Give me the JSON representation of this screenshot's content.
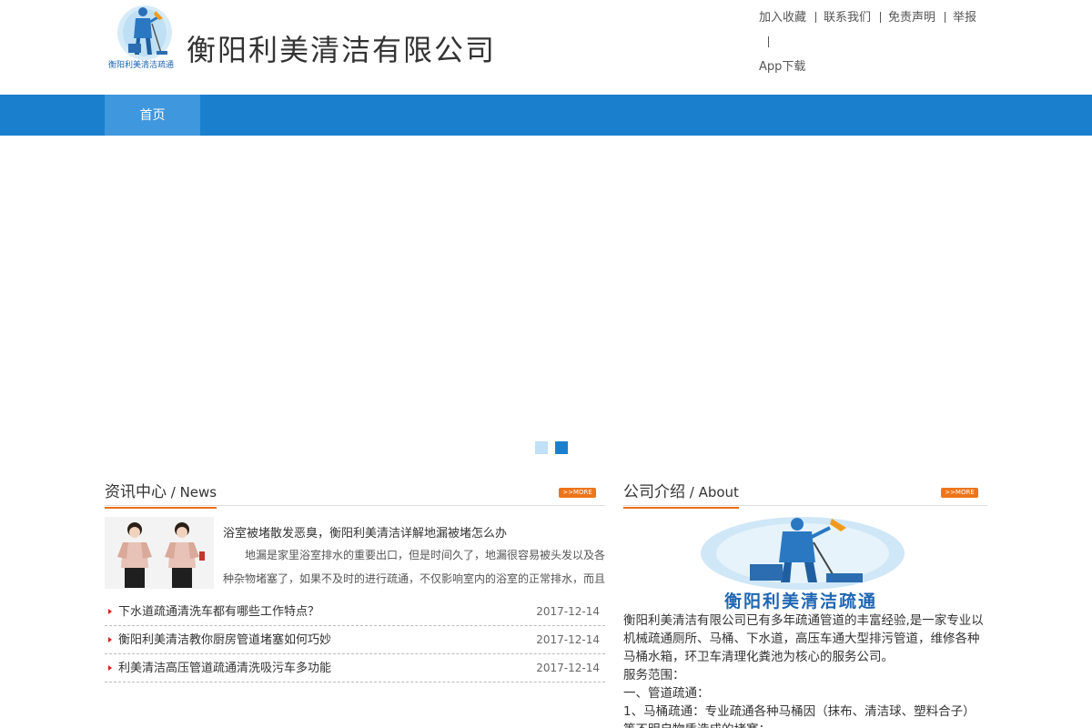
{
  "header": {
    "site_name": "衡阳利美清洁有限公司",
    "logo_caption": "衡阳利美清洁疏通",
    "links": [
      "加入收藏",
      "联系我们",
      "免责声明",
      "举报",
      "App下载"
    ]
  },
  "nav": {
    "items": [
      {
        "label": "首页"
      }
    ]
  },
  "banner": {
    "slides_count": 2,
    "active_slide": 2
  },
  "news": {
    "title_cn": "资讯中心",
    "title_en": " / News",
    "more_label": ">>MORE",
    "featured": {
      "title": "浴室被堵散发恶臭，衡阳利美清洁详解地漏被堵怎么办",
      "desc": "地漏是家里浴室排水的重要出口，但是时间久了，地漏很容易被头发以及各种杂物堵塞了，如果不及时的进行疏通，不仅影响室内的浴室的正常排水，而且"
    },
    "items": [
      {
        "title": "下水道疏通清洗车都有哪些工作特点？",
        "date": "2017-12-14"
      },
      {
        "title": "衡阳利美清洁教你厨房管道堵塞如何巧妙",
        "date": "2017-12-14"
      },
      {
        "title": "利美清洁高压管道疏通清洗吸污车多功能",
        "date": "2017-12-14"
      }
    ]
  },
  "about": {
    "title_cn": "公司介绍",
    "title_en": " / About",
    "more_label": ">>MORE",
    "logo_caption": "衡阳利美清洁疏通",
    "paragraphs": [
      "衡阳利美清洁有限公司已有多年疏通管道的丰富经验,是一家专业以机械疏通厕所、马桶、下水道，高压车通大型排污管道，维修各种马桶水箱，环卫车清理化粪池为核心的服务公司。",
      "服务范围：",
      "一、管道疏通：",
      "1、马桶疏通：专业疏通各种马桶因（抹布、清洁球、塑料合子）等不明自物质造成的堵塞；"
    ]
  },
  "colors": {
    "nav_bg": "#1a80cd",
    "nav_active": "#3f97dd",
    "accent": "#ea6e13",
    "bullet": "#d9201f"
  }
}
